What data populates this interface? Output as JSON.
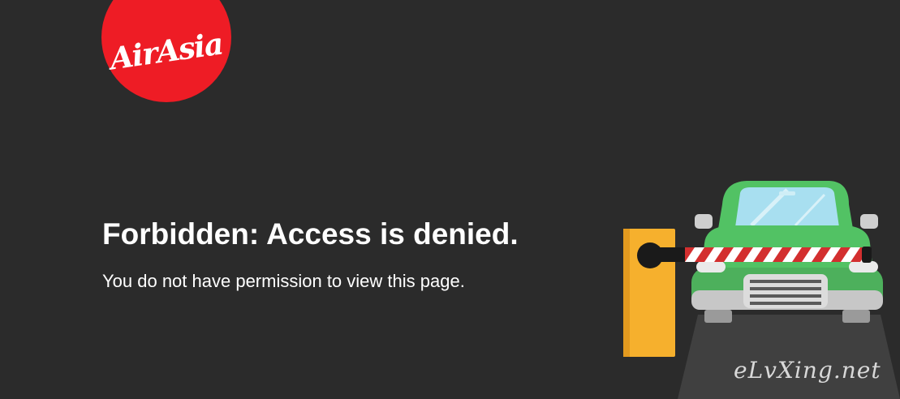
{
  "logo": {
    "text": "AirAsia",
    "color": "#ee1c25"
  },
  "error": {
    "title": "Forbidden: Access is denied.",
    "message": "You do not have permission to view this page."
  },
  "illustration": {
    "name": "car-at-barrier-gate"
  },
  "watermark": {
    "text": "eLvXing.net"
  },
  "colors": {
    "background": "#2b2b2b",
    "car": "#52c264",
    "gate_post": "#f6b02d"
  }
}
